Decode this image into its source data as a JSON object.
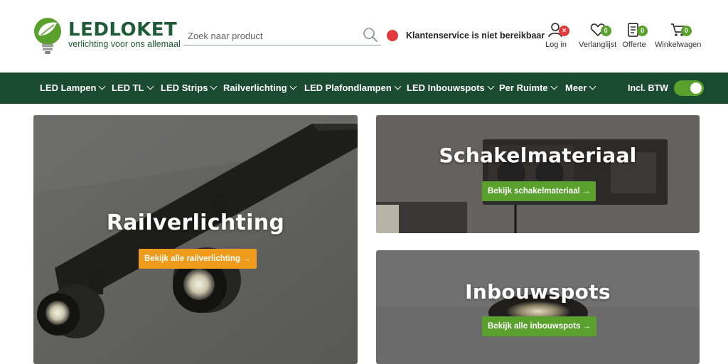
{
  "brand": {
    "name": "LEDLOKET",
    "tagline": "verlichting voor ons allemaal",
    "color": "#1d5c36"
  },
  "search": {
    "placeholder": "Zoek naar product",
    "value": ""
  },
  "service_status": {
    "text": "Klantenservice is niet bereikbaar",
    "color": "#e23b3b"
  },
  "header_actions": [
    {
      "label": "Log in",
      "icon": "user-icon",
      "badge": "×"
    },
    {
      "label": "Verlanglijst",
      "icon": "heart-icon",
      "badge": "0"
    },
    {
      "label": "Offerte",
      "icon": "document-icon",
      "badge": "0"
    },
    {
      "label": "Winkelwagen",
      "icon": "cart-icon",
      "badge": "0"
    }
  ],
  "nav": {
    "items": [
      {
        "label": "LED Lampen"
      },
      {
        "label": "LED TL"
      },
      {
        "label": "LED Strips"
      },
      {
        "label": "Railverlichting"
      },
      {
        "label": "LED Plafondlampen"
      },
      {
        "label": "LED Inbouwspots"
      },
      {
        "label": "Per Ruimte"
      },
      {
        "label": "Meer"
      }
    ],
    "vat_toggle": {
      "label": "Incl. BTW",
      "on": true
    }
  },
  "tiles": [
    {
      "title": "Railverlichting",
      "cta": "Bekijk alle railverlichting →"
    },
    {
      "title": "Schakelmateriaal",
      "cta": "Bekijk schakelmateriaal →"
    },
    {
      "title": "Inbouwspots",
      "cta": "Bekijk alle inbouwspots →"
    }
  ],
  "colors": {
    "nav_bg": "#1a4b31",
    "accent_green": "#5aa02c",
    "accent_orange": "#ee9a1a",
    "alert_red": "#e23b3b"
  }
}
